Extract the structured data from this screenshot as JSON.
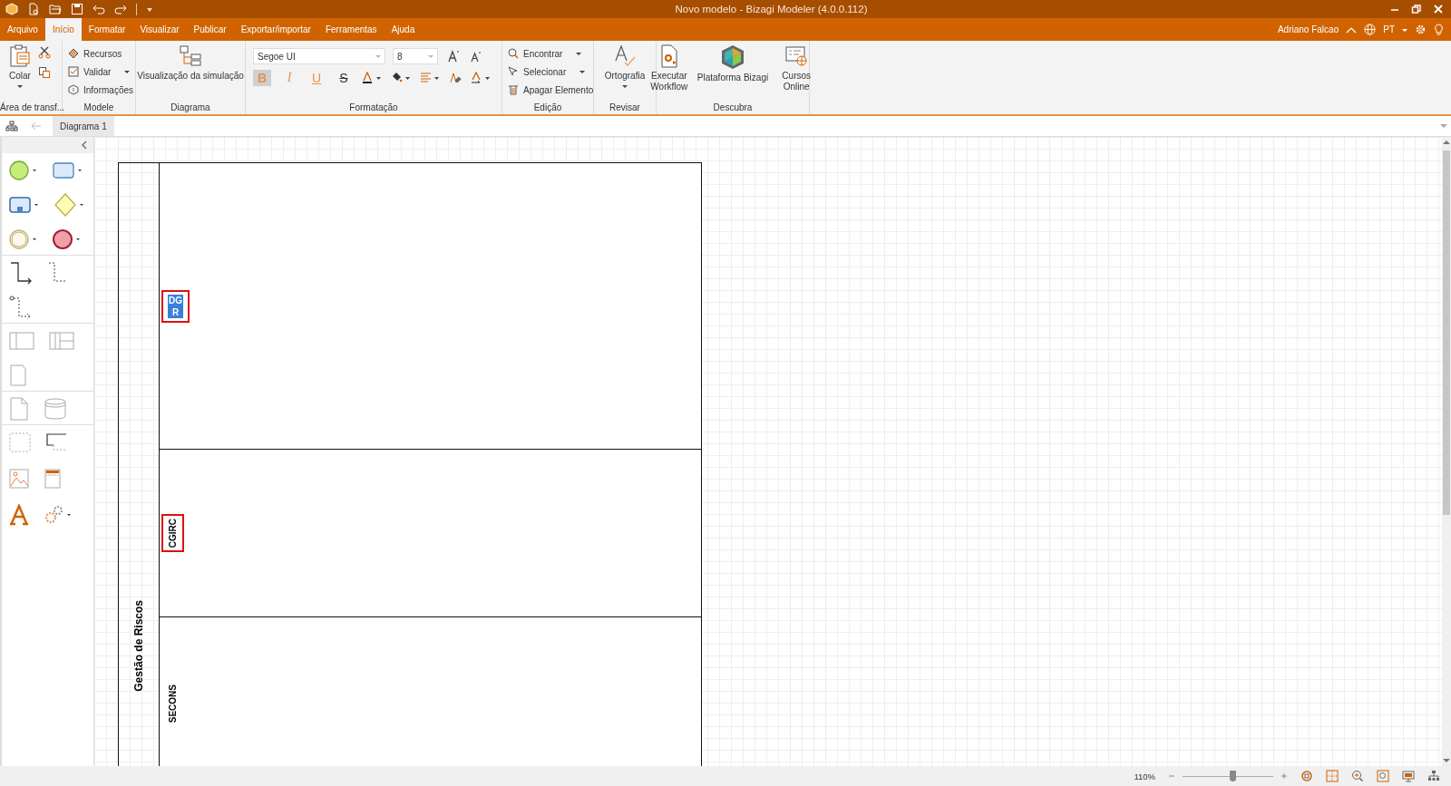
{
  "window": {
    "title": "Novo modelo - Bizagi Modeler (4.0.0.112)"
  },
  "menu_tabs": [
    {
      "label": "Arquivo",
      "selected": false
    },
    {
      "label": "Início",
      "selected": true
    },
    {
      "label": "Formatar",
      "selected": false
    },
    {
      "label": "Visualizar",
      "selected": false
    },
    {
      "label": "Publicar",
      "selected": false
    },
    {
      "label": "Exportar/importar",
      "selected": false
    },
    {
      "label": "Ferramentas",
      "selected": false
    },
    {
      "label": "Ajuda",
      "selected": false
    }
  ],
  "user": {
    "name": "Adriano Falcao",
    "language": "PT"
  },
  "ribbon": {
    "groups": [
      {
        "label": "Área de transf...",
        "items": [
          "Colar"
        ]
      },
      {
        "label": "Modele",
        "items": [
          "Recursos",
          "Validar",
          "Informações"
        ]
      },
      {
        "label": "Diagrama",
        "items": [
          "Visualização da simulação"
        ]
      },
      {
        "label": "Formatação",
        "font": "Segoe UI",
        "size": "8",
        "format_buttons": [
          {
            "label": "B",
            "selected": true
          },
          {
            "label": "I",
            "selected": false
          },
          {
            "label": "U",
            "selected": false
          },
          {
            "label": "S",
            "selected": false
          }
        ]
      },
      {
        "label": "Edição",
        "items": [
          "Encontrar",
          "Selecionar",
          "Apagar Elemento"
        ]
      },
      {
        "label": "Revisar",
        "items": [
          "Ortografia"
        ]
      },
      {
        "label": "Descubra",
        "items": [
          "Executar Workflow",
          "Plataforma Bizagi",
          "Cursos Online"
        ]
      }
    ]
  },
  "doc_tabs": [
    {
      "label": "Diagrama 1",
      "selected": true
    }
  ],
  "pool": {
    "label": "Gestão de Riscos",
    "lanes": [
      {
        "label": "DGR",
        "highlighted": true,
        "editing": true
      },
      {
        "label": "CGIRC",
        "highlighted": true,
        "editing": false
      },
      {
        "label": "SECONS",
        "highlighted": false,
        "editing": false
      }
    ]
  },
  "status": {
    "zoom": "110%",
    "zoom_slider": {
      "level": 0.55
    }
  }
}
